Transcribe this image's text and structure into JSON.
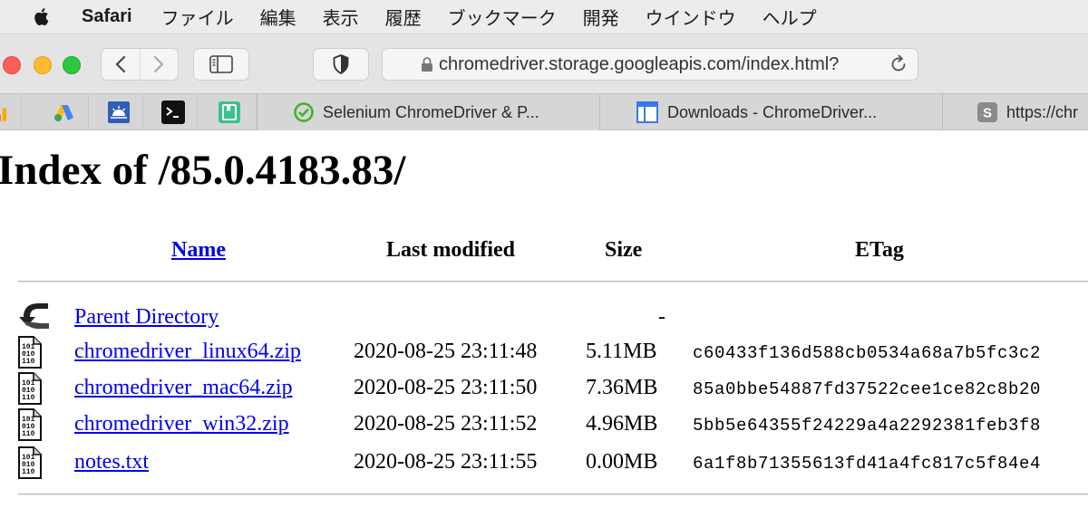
{
  "menubar": {
    "app": "Safari",
    "items": [
      "ファイル",
      "編集",
      "表示",
      "履歴",
      "ブックマーク",
      "開発",
      "ウインドウ",
      "ヘルプ"
    ]
  },
  "toolbar": {
    "url": "chromedriver.storage.googleapis.com/index.html?"
  },
  "tabs": [
    {
      "title": "Selenium ChromeDriver & P...",
      "icon": "selenium-icon"
    },
    {
      "title": "Downloads - ChromeDriver...",
      "icon": "chromedriver-icon"
    },
    {
      "title": "https://chr",
      "icon": "s-letter-icon"
    }
  ],
  "page": {
    "title": "Index of /85.0.4183.83/",
    "headers": {
      "name": "Name",
      "modified": "Last modified",
      "size": "Size",
      "etag": "ETag"
    },
    "parent": {
      "name": "Parent Directory",
      "size": "-"
    },
    "files": [
      {
        "name": "chromedriver_linux64.zip",
        "modified": "2020-08-25 23:11:48",
        "size": "5.11MB",
        "etag": "c60433f136d588cb0534a68a7b5fc3c2"
      },
      {
        "name": "chromedriver_mac64.zip",
        "modified": "2020-08-25 23:11:50",
        "size": "7.36MB",
        "etag": "85a0bbe54887fd37522cee1ce82c8b20"
      },
      {
        "name": "chromedriver_win32.zip",
        "modified": "2020-08-25 23:11:52",
        "size": "4.96MB",
        "etag": "5bb5e64355f24229a4a2292381feb3f8"
      },
      {
        "name": "notes.txt",
        "modified": "2020-08-25 23:11:55",
        "size": "0.00MB",
        "etag": "6a1f8b71355613fd41a4fc817c5f84e4"
      }
    ]
  }
}
